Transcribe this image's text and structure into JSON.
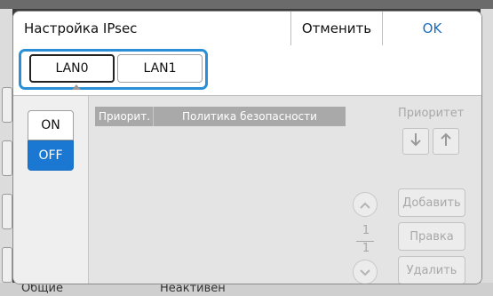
{
  "dialog": {
    "title": "Настройка IPsec",
    "cancel_label": "Отменить",
    "ok_label": "OK"
  },
  "lan_tabs": [
    {
      "label": "LAN0",
      "selected": true
    },
    {
      "label": "LAN1",
      "selected": false
    }
  ],
  "ipsec_toggle": {
    "on_label": "ON",
    "off_label": "OFF",
    "selected": "OFF"
  },
  "policy_table": {
    "columns": [
      "Приорит.",
      "Политика безопасности"
    ],
    "rows": []
  },
  "priority": {
    "label": "Приоритет",
    "down_icon": "arrow-down-icon",
    "up_icon": "arrow-up-icon"
  },
  "actions": {
    "add_label": "Добавить",
    "edit_label": "Правка",
    "delete_label": "Удалить"
  },
  "pagination": {
    "current": "1",
    "total": "1"
  },
  "background": {
    "partial_left": "Общие",
    "partial_center": "Неактивен"
  },
  "colors": {
    "accent": "#1a78d2",
    "highlight": "#2a8fd6",
    "ok_text": "#1a6ec0",
    "disabled_text": "#a8a8a8",
    "table_header": "#a9a9a9"
  }
}
